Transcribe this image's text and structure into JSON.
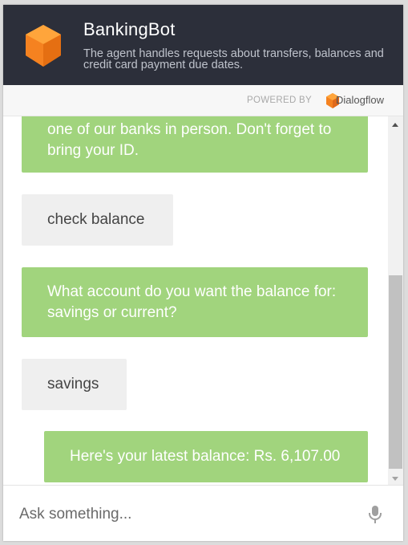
{
  "header": {
    "title": "BankingBot",
    "description": "The agent handles requests about transfers, balances and credit card payment due dates.",
    "logo_icon": "orange-cube-icon",
    "background_color": "#2c2f3a"
  },
  "powered_by": {
    "label": "POWERED BY",
    "brand_name": "Dialogflow",
    "brand_icon": "dialogflow-icon"
  },
  "messages": [
    {
      "sender": "bot",
      "text": "one of our banks in person. Don't forget to bring your ID."
    },
    {
      "sender": "user",
      "text": "check balance"
    },
    {
      "sender": "bot",
      "text": "What account do you want the balance for: savings or current?"
    },
    {
      "sender": "user",
      "text": "savings"
    },
    {
      "sender": "bot",
      "text": "Here's your latest balance: Rs. 6,107.00"
    }
  ],
  "input": {
    "placeholder": "Ask something...",
    "value": "",
    "mic_icon": "microphone-icon"
  },
  "colors": {
    "bot_bubble": "#a1d47d",
    "user_bubble": "#efefef",
    "brand_orange": "#f58220"
  }
}
